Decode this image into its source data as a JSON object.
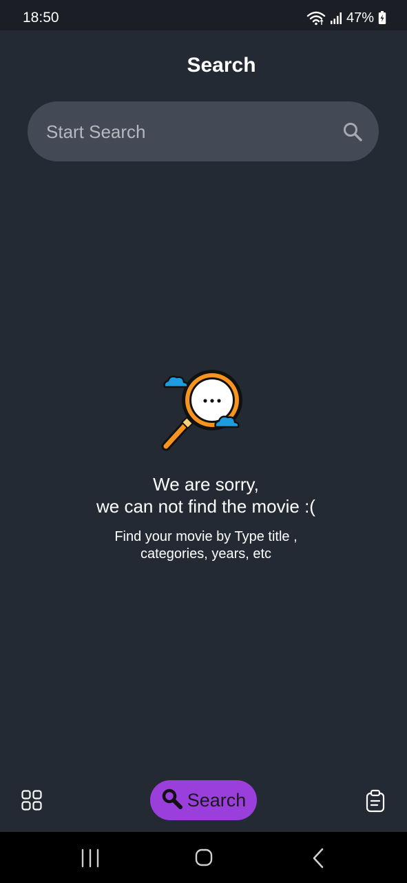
{
  "status_bar": {
    "time": "18:50",
    "battery": "47%",
    "icons": [
      "wifi-icon",
      "signal-icon",
      "battery-charging-icon"
    ]
  },
  "header": {
    "title": "Search"
  },
  "search": {
    "placeholder": "Start Search",
    "value": "",
    "icon": "search-icon"
  },
  "empty_state": {
    "illustration": "magnifier-clouds-illustration",
    "title_line1": "We are sorry,",
    "title_line2": "we can not find the movie :(",
    "subtitle_line1": "Find your movie by Type title ,",
    "subtitle_line2": "categories, years, etc"
  },
  "bottom_nav": {
    "items": [
      {
        "icon": "grid-icon",
        "label": ""
      },
      {
        "icon": "search-icon",
        "label": "Search"
      },
      {
        "icon": "clipboard-icon",
        "label": ""
      }
    ],
    "active_color": "#9b3fdc"
  },
  "system_nav": {
    "icons": [
      "recent-apps-icon",
      "home-icon",
      "back-icon"
    ]
  },
  "colors": {
    "background": "#242a33",
    "status_bar": "#1b1f25",
    "search_field": "#434a55",
    "accent": "#9b3fdc",
    "illustration_orange": "#f7941d",
    "illustration_blue": "#1e9ce0"
  }
}
